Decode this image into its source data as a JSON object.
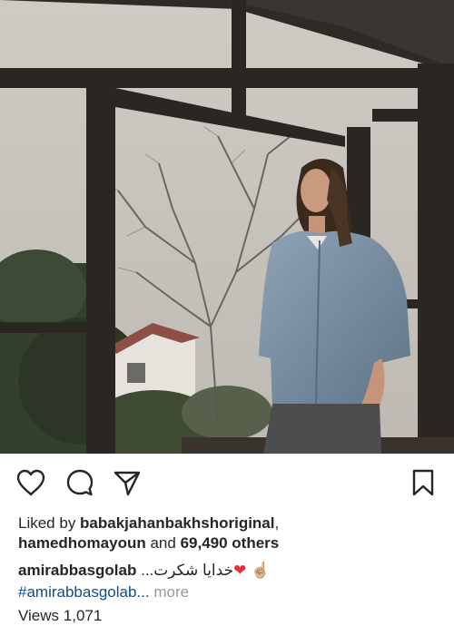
{
  "post": {
    "photo_alt": "",
    "actions": {
      "like_icon": "heart-outline-icon",
      "comment_icon": "comment-bubble-icon",
      "share_icon": "paper-plane-icon",
      "save_icon": "bookmark-icon"
    },
    "likes": {
      "prefix": "Liked by ",
      "user1": "babakjahanbakhshoriginal",
      "separator": ",",
      "user2": "hamedhomayoun",
      "middle": " and ",
      "others": "69,490 others"
    },
    "caption": {
      "username": "amirabbasgolab",
      "text": "خدایا شکرت...",
      "heart": "❤",
      "hand": "☝🏼"
    },
    "hashtag": "#amirabbasgolab...",
    "more_label": "more",
    "views_text": "Views 1,071",
    "colors": {
      "heart": "#ed2d3d",
      "hashtag": "#0f4d8a",
      "muted": "#999999",
      "text": "#262626"
    }
  }
}
